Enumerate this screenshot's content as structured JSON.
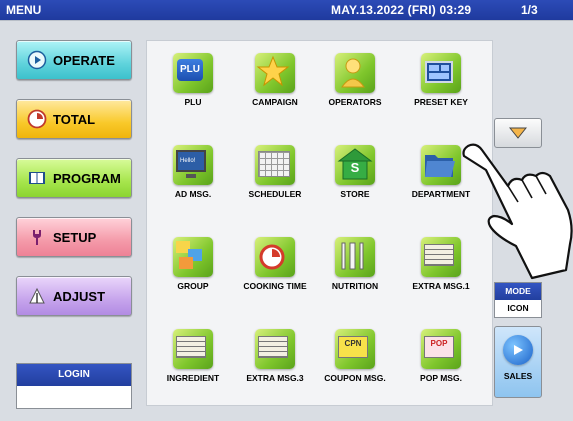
{
  "header": {
    "title": "MENU",
    "datetime": "MAY.13.2022 (FRI)  03:29",
    "page_indicator": "1/3"
  },
  "sidebar": {
    "items": [
      {
        "label": "OPERATE",
        "icon": "play-icon"
      },
      {
        "label": "TOTAL",
        "icon": "clock-icon"
      },
      {
        "label": "PROGRAM",
        "icon": "book-icon"
      },
      {
        "label": "SETUP",
        "icon": "wrench-icon"
      },
      {
        "label": "ADJUST",
        "icon": "adjust-icon"
      }
    ],
    "login": {
      "label": "LOGIN",
      "value": ""
    }
  },
  "tiles": [
    {
      "label": "PLU",
      "icon": "plu-icon"
    },
    {
      "label": "CAMPAIGN",
      "icon": "star-icon"
    },
    {
      "label": "OPERATORS",
      "icon": "person-icon"
    },
    {
      "label": "PRESET KEY",
      "icon": "keyboard-icon"
    },
    {
      "label": "AD MSG.",
      "icon": "monitor-icon"
    },
    {
      "label": "SCHEDULER",
      "icon": "calendar-icon"
    },
    {
      "label": "STORE",
      "icon": "store-icon"
    },
    {
      "label": "DEPARTMENT",
      "icon": "folder-icon"
    },
    {
      "label": "GROUP",
      "icon": "group-icon"
    },
    {
      "label": "COOKING TIME",
      "icon": "timer-icon"
    },
    {
      "label": "NUTRITION",
      "icon": "cutlery-icon"
    },
    {
      "label": "EXTRA MSG.1",
      "icon": "note-icon"
    },
    {
      "label": "INGREDIENT",
      "icon": "note-icon"
    },
    {
      "label": "EXTRA MSG.3",
      "icon": "note-icon"
    },
    {
      "label": "COUPON MSG.",
      "icon": "coupon-icon"
    },
    {
      "label": "POP MSG.",
      "icon": "pop-icon"
    }
  ],
  "tile_icon_text": {
    "plu": "PLU",
    "ad": "Hello!",
    "store": "S",
    "coupon": "CPN",
    "pop": "POP"
  },
  "right": {
    "next_arrow": "down-triangle-icon",
    "mode": {
      "label": "MODE",
      "value": "ICON"
    },
    "sales_label": "SALES"
  },
  "colors": {
    "header_blue": "#2c4bb7",
    "tile_green": "#7fc62c",
    "operate": "#5fd3dc",
    "total": "#f9c92a",
    "program": "#a6e54c",
    "setup": "#f49aa9",
    "adjust": "#c6a4ec"
  }
}
